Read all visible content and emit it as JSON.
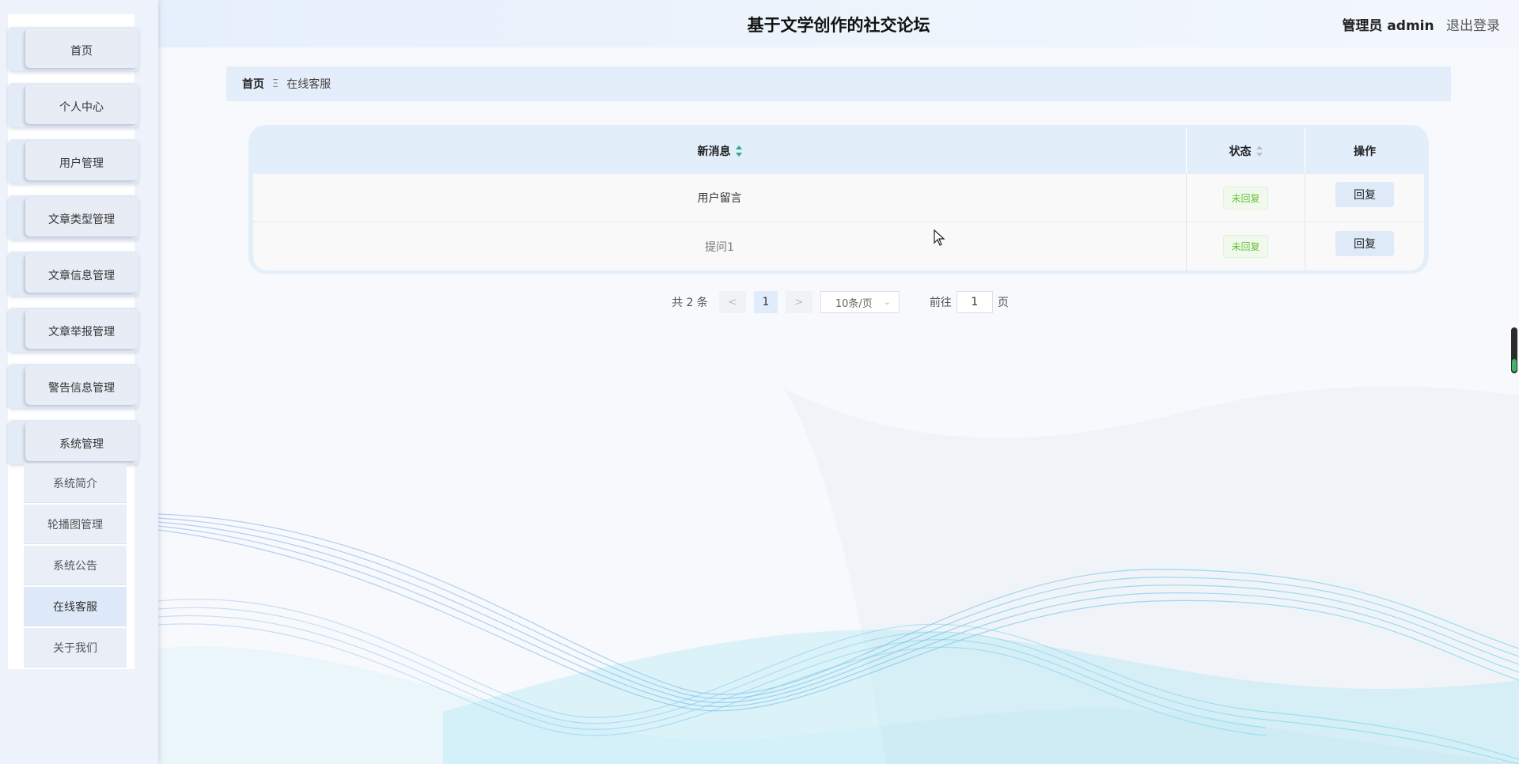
{
  "header": {
    "title": "基于文学创作的社交论坛",
    "user_role": "管理员 admin",
    "logout": "退出登录"
  },
  "sidebar": {
    "menu": [
      {
        "label": "首页"
      },
      {
        "label": "个人中心"
      },
      {
        "label": "用户管理"
      },
      {
        "label": "文章类型管理"
      },
      {
        "label": "文章信息管理"
      },
      {
        "label": "文章举报管理"
      },
      {
        "label": "警告信息管理"
      },
      {
        "label": "系统管理"
      }
    ],
    "submenu": [
      {
        "label": "系统简介"
      },
      {
        "label": "轮播图管理"
      },
      {
        "label": "系统公告"
      },
      {
        "label": "在线客服",
        "active": true
      },
      {
        "label": "关于我们"
      }
    ]
  },
  "breadcrumb": {
    "home": "首页",
    "separator": "Ξ",
    "current": "在线客服"
  },
  "table": {
    "columns": [
      "新消息",
      "状态",
      "操作"
    ],
    "rows": [
      {
        "message": "用户留言",
        "status": "未回复",
        "action": "回复"
      },
      {
        "message": "提问1",
        "status": "未回复",
        "action": "回复"
      }
    ]
  },
  "pagination": {
    "total": "共 2 条",
    "prev": "<",
    "current_page": "1",
    "next": ">",
    "page_size": "10条/页",
    "goto_label": "前往",
    "goto_value": "1",
    "page_suffix": "页"
  },
  "colors": {
    "accent": "#e3eefb",
    "tag_green": "#67c23a",
    "sort_active": "#2aa98a"
  }
}
